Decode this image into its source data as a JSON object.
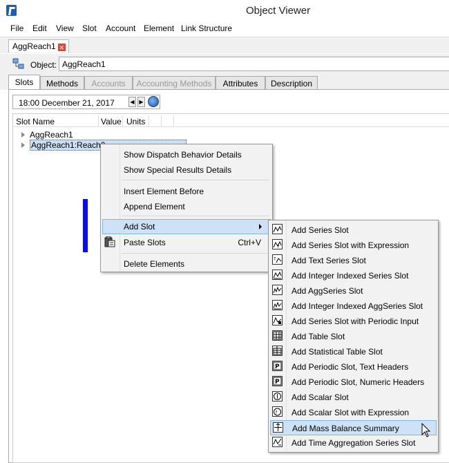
{
  "window": {
    "title": "Object Viewer"
  },
  "menubar": [
    "File",
    "Edit",
    "View",
    "Slot",
    "Account",
    "Element",
    "Link Structure"
  ],
  "doc_tab": {
    "label": "AggReach1"
  },
  "object": {
    "label": "Object:",
    "value": "AggReach1"
  },
  "tabs": [
    {
      "label": "Slots",
      "state": "active"
    },
    {
      "label": "Methods",
      "state": "normal"
    },
    {
      "label": "Accounts",
      "state": "disabled"
    },
    {
      "label": "Accounting Methods",
      "state": "disabled"
    },
    {
      "label": "Attributes",
      "state": "normal"
    },
    {
      "label": "Description",
      "state": "normal"
    }
  ],
  "date": {
    "value": "18:00 December 21, 2017"
  },
  "tree": {
    "columns": [
      "Slot Name",
      "Value",
      "Units"
    ],
    "rows": [
      "AggReach1",
      "AggReach1:Reach0"
    ]
  },
  "context_menu": {
    "items": [
      {
        "label": "Show Dispatch Behavior Details",
        "shortcut": ""
      },
      {
        "label": "Show Special Results Details",
        "shortcut": ""
      },
      {
        "label": "Insert Element Before",
        "shortcut": ""
      },
      {
        "label": "Append Element",
        "shortcut": ""
      },
      {
        "label": "Add Slot",
        "shortcut": ""
      },
      {
        "label": "Paste Slots",
        "shortcut": "Ctrl+V"
      },
      {
        "label": "Delete Elements",
        "shortcut": ""
      }
    ]
  },
  "submenu": {
    "items": [
      {
        "label": "Add Series Slot",
        "icon": "series-slot-icon"
      },
      {
        "label": "Add Series Slot with Expression",
        "icon": "series-expression-icon"
      },
      {
        "label": "Add Text Series Slot",
        "icon": "text-series-icon"
      },
      {
        "label": "Add Integer Indexed Series Slot",
        "icon": "integer-series-icon"
      },
      {
        "label": "Add AggSeries Slot",
        "icon": "aggseries-icon"
      },
      {
        "label": "Add Integer Indexed AggSeries Slot",
        "icon": "integer-aggseries-icon"
      },
      {
        "label": "Add Series Slot with Periodic Input",
        "icon": "periodic-input-icon"
      },
      {
        "label": "Add Table Slot",
        "icon": "table-slot-icon"
      },
      {
        "label": "Add Statistical Table Slot",
        "icon": "statistical-table-icon"
      },
      {
        "label": "Add Periodic Slot, Text Headers",
        "icon": "periodic-text-icon"
      },
      {
        "label": "Add Periodic Slot, Numeric Headers",
        "icon": "periodic-numeric-icon"
      },
      {
        "label": "Add Scalar Slot",
        "icon": "scalar-slot-icon"
      },
      {
        "label": "Add Scalar Slot with Expression",
        "icon": "scalar-expression-icon"
      },
      {
        "label": "Add Mass Balance Summary",
        "icon": "mass-balance-icon"
      },
      {
        "label": "Add Time Aggregation Series Slot",
        "icon": "time-aggregation-icon"
      }
    ]
  },
  "colors": {
    "highlight": "#cde2f6",
    "marker": "#0a0af0"
  }
}
